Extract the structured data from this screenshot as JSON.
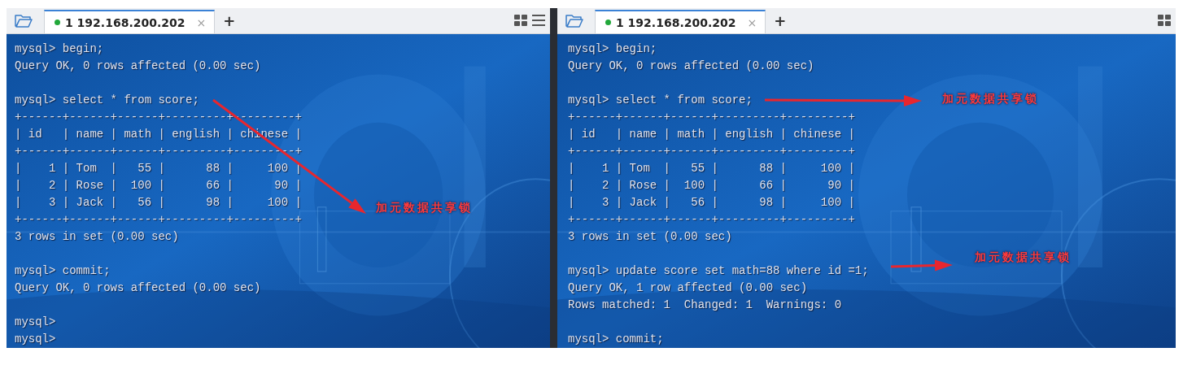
{
  "panes": [
    {
      "tab": {
        "label": "1 192.168.200.202",
        "connected": true,
        "selected": true,
        "close": "×"
      },
      "new_tab": "+",
      "blocks": [
        [
          "mysql> begin;",
          "Query OK, 0 rows affected (0.00 sec)"
        ],
        [
          "mysql> select * from score;",
          "+------+------+------+---------+---------+",
          "| id   | name | math | english | chinese |",
          "+------+------+------+---------+---------+",
          "|    1 | Tom  |   55 |      88 |     100 |",
          "|    2 | Rose |  100 |      66 |      90 |",
          "|    3 | Jack |   56 |      98 |     100 |",
          "+------+------+------+---------+---------+",
          "3 rows in set (0.00 sec)"
        ],
        [
          "mysql> commit;",
          "Query OK, 0 rows affected (0.00 sec)"
        ],
        [
          "mysql>",
          "mysql>"
        ]
      ],
      "annotations": [
        {
          "text": "加元数据共享锁"
        }
      ]
    },
    {
      "tab": {
        "label": "1 192.168.200.202",
        "connected": true,
        "selected": true,
        "close": "×"
      },
      "new_tab": "+",
      "blocks": [
        [
          "mysql> begin;",
          "Query OK, 0 rows affected (0.00 sec)"
        ],
        [
          "mysql> select * from score;",
          "+------+------+------+---------+---------+",
          "| id   | name | math | english | chinese |",
          "+------+------+------+---------+---------+",
          "|    1 | Tom  |   55 |      88 |     100 |",
          "|    2 | Rose |  100 |      66 |      90 |",
          "|    3 | Jack |   56 |      98 |     100 |",
          "+------+------+------+---------+---------+",
          "3 rows in set (0.00 sec)"
        ],
        [
          "mysql> update score set math=88 where id =1;",
          "Query OK, 1 row affected (0.00 sec)",
          "Rows matched: 1  Changed: 1  Warnings: 0"
        ],
        [
          "mysql> commit;"
        ]
      ],
      "annotations": [
        {
          "text": "加元数据共享锁"
        },
        {
          "text": "加元数据共享锁"
        }
      ]
    }
  ]
}
